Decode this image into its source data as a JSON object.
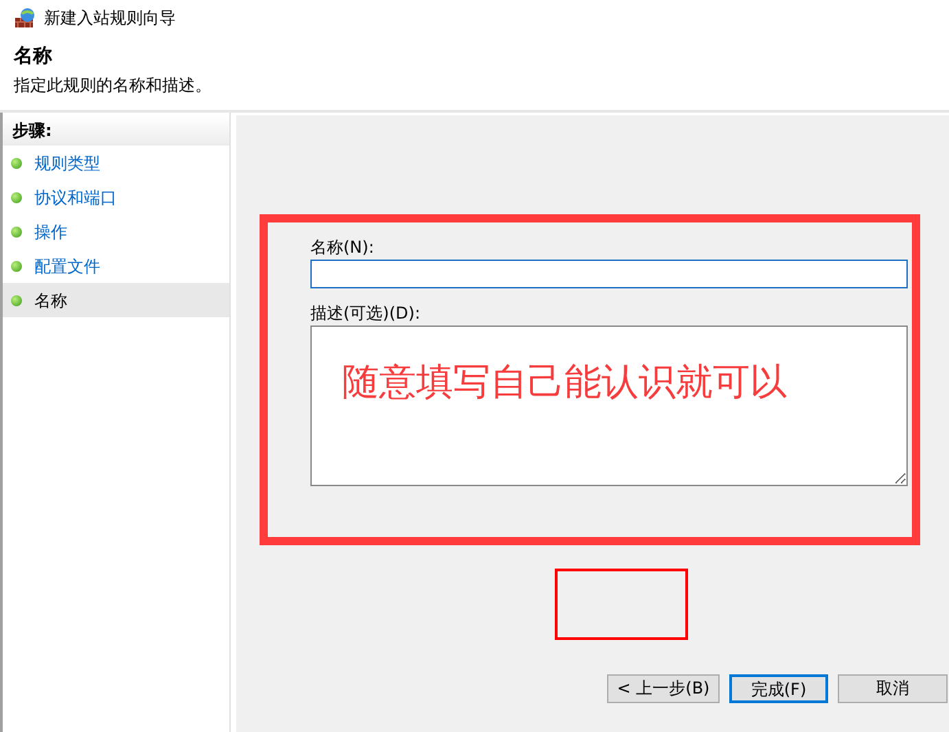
{
  "window": {
    "title": "新建入站规则向导"
  },
  "header": {
    "title": "名称",
    "subtitle": "指定此规则的名称和描述。"
  },
  "sidebar": {
    "heading": "步骤:",
    "items": [
      {
        "label": "规则类型",
        "selected": false
      },
      {
        "label": "协议和端口",
        "selected": false
      },
      {
        "label": "操作",
        "selected": false
      },
      {
        "label": "配置文件",
        "selected": false
      },
      {
        "label": "名称",
        "selected": true
      }
    ]
  },
  "form": {
    "name_label": "名称(N):",
    "description_label": "描述(可选)(D):"
  },
  "annotation": {
    "text": "随意填写自己能认识就可以"
  },
  "buttons": [
    {
      "label": "< 上一步(B)",
      "default": false
    },
    {
      "label": "完成(F)",
      "default": true
    },
    {
      "label": "取消",
      "default": false
    }
  ]
}
